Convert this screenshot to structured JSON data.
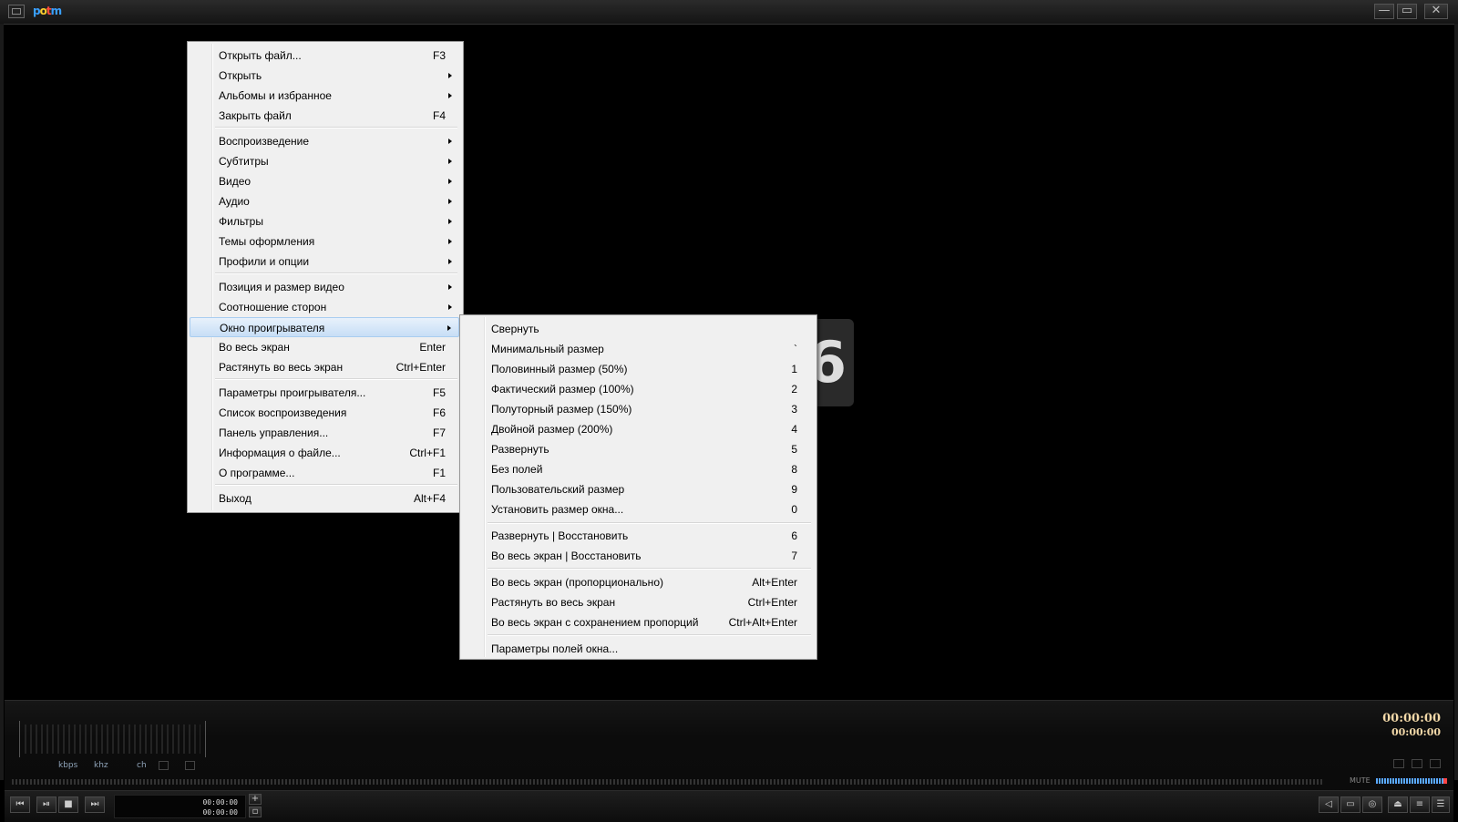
{
  "titlebar": {
    "logo_parts": [
      "p",
      "o",
      "t",
      "m"
    ],
    "buttons": [
      "—",
      "▭",
      "✕"
    ]
  },
  "video": {
    "logo_glyph": "6"
  },
  "main_menu": {
    "items": [
      {
        "label": "Открыть файл...",
        "shortcut": "F3",
        "submenu": false
      },
      {
        "label": "Открыть",
        "shortcut": "",
        "submenu": true
      },
      {
        "label": "Альбомы и избранное",
        "shortcut": "",
        "submenu": true
      },
      {
        "label": "Закрыть файл",
        "shortcut": "F4",
        "submenu": false
      },
      {
        "label": "Воспроизведение",
        "shortcut": "",
        "submenu": true
      },
      {
        "label": "Субтитры",
        "shortcut": "",
        "submenu": true
      },
      {
        "label": "Видео",
        "shortcut": "",
        "submenu": true
      },
      {
        "label": "Аудио",
        "shortcut": "",
        "submenu": true
      },
      {
        "label": "Фильтры",
        "shortcut": "",
        "submenu": true
      },
      {
        "label": "Темы оформления",
        "shortcut": "",
        "submenu": true
      },
      {
        "label": "Профили и опции",
        "shortcut": "",
        "submenu": true
      },
      {
        "label": "Позиция и размер видео",
        "shortcut": "",
        "submenu": true
      },
      {
        "label": "Соотношение сторон",
        "shortcut": "",
        "submenu": true
      },
      {
        "label": "Окно проигрывателя",
        "shortcut": "",
        "submenu": true
      },
      {
        "label": "Во весь экран",
        "shortcut": "Enter",
        "submenu": false
      },
      {
        "label": "Растянуть во весь экран",
        "shortcut": "Ctrl+Enter",
        "submenu": false
      },
      {
        "label": "Параметры проигрывателя...",
        "shortcut": "F5",
        "submenu": false
      },
      {
        "label": "Список воспроизведения",
        "shortcut": "F6",
        "submenu": false
      },
      {
        "label": "Панель управления...",
        "shortcut": "F7",
        "submenu": false
      },
      {
        "label": "Информация о файле...",
        "shortcut": "Ctrl+F1",
        "submenu": false
      },
      {
        "label": "О программе...",
        "shortcut": "F1",
        "submenu": false
      },
      {
        "label": "Выход",
        "shortcut": "Alt+F4",
        "submenu": false
      }
    ]
  },
  "sub_menu": {
    "items": [
      {
        "label": "Свернуть",
        "shortcut": ""
      },
      {
        "label": "Минимальный размер",
        "shortcut": "`"
      },
      {
        "label": "Половинный размер (50%)",
        "shortcut": "1"
      },
      {
        "label": "Фактический размер (100%)",
        "shortcut": "2"
      },
      {
        "label": "Полуторный размер (150%)",
        "shortcut": "3"
      },
      {
        "label": "Двойной размер (200%)",
        "shortcut": "4"
      },
      {
        "label": "Развернуть",
        "shortcut": "5"
      },
      {
        "label": "Без полей",
        "shortcut": "8"
      },
      {
        "label": "Пользовательский размер",
        "shortcut": "9"
      },
      {
        "label": "Установить размер окна...",
        "shortcut": "0"
      },
      {
        "label": "Развернуть | Восстановить",
        "shortcut": "6"
      },
      {
        "label": "Во весь экран | Восстановить",
        "shortcut": "7"
      },
      {
        "label": "Во весь экран (пропорционально)",
        "shortcut": "Alt+Enter"
      },
      {
        "label": "Растянуть во весь экран",
        "shortcut": "Ctrl+Enter"
      },
      {
        "label": "Во весь экран с сохранением пропорций",
        "shortcut": "Ctrl+Alt+Enter"
      },
      {
        "label": "Параметры полей окна...",
        "shortcut": ""
      }
    ]
  },
  "panel": {
    "labels": {
      "kbps": "kbps",
      "khz": "khz",
      "ch": "ch"
    },
    "time_total": "00:00:00",
    "time_current": "00:00:00",
    "small_time_1": "00:00:00",
    "small_time_2": "00:00:00",
    "mute_label": "MUTE"
  },
  "colors": {
    "accent_time": "#f2d8a8",
    "menu_bg": "#f0f0f0",
    "volume": "#5aa9ff"
  }
}
